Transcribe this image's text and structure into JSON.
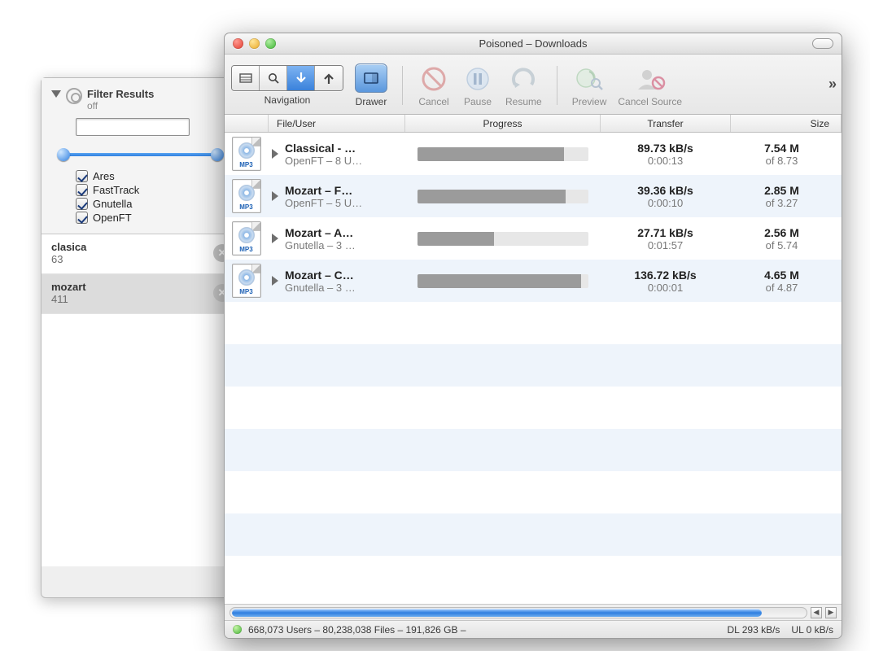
{
  "window_title": "Poisoned – Downloads",
  "toolbar": {
    "navigation_label": "Navigation",
    "drawer_label": "Drawer",
    "cancel": "Cancel",
    "pause": "Pause",
    "resume": "Resume",
    "preview": "Preview",
    "cancel_source": "Cancel Source"
  },
  "columns": {
    "file": "File/User",
    "progress": "Progress",
    "transfer": "Transfer",
    "size": "Size"
  },
  "downloads": [
    {
      "name": "Classical - …",
      "source": "OpenFT – 8 U…",
      "progress": 86,
      "rate": "89.73 kB/s",
      "time": "0:00:13",
      "size": "7.54 M",
      "of": "of 8.73"
    },
    {
      "name": "Mozart – F…",
      "source": "OpenFT – 5 U…",
      "progress": 87,
      "rate": "39.36 kB/s",
      "time": "0:00:10",
      "size": "2.85 M",
      "of": "of 3.27"
    },
    {
      "name": "Mozart – A…",
      "source": "Gnutella – 3 …",
      "progress": 45,
      "rate": "27.71 kB/s",
      "time": "0:01:57",
      "size": "2.56 M",
      "of": "of 5.74"
    },
    {
      "name": "Mozart – C…",
      "source": "Gnutella – 3 …",
      "progress": 96,
      "rate": "136.72 kB/s",
      "time": "0:00:01",
      "size": "4.65 M",
      "of": "of 4.87"
    }
  ],
  "status": {
    "main": "668,073 Users – 80,238,038 Files – 191,826 GB –",
    "dl": "DL 293 kB/s",
    "ul": "UL 0 kB/s"
  },
  "drawer": {
    "title": "Filter Results",
    "subtitle": "off",
    "networks": [
      "Ares",
      "FastTrack",
      "Gnutella",
      "OpenFT"
    ],
    "searches": [
      {
        "name": "clasica",
        "count": "63",
        "selected": false
      },
      {
        "name": "mozart",
        "count": "411",
        "selected": true
      }
    ]
  }
}
